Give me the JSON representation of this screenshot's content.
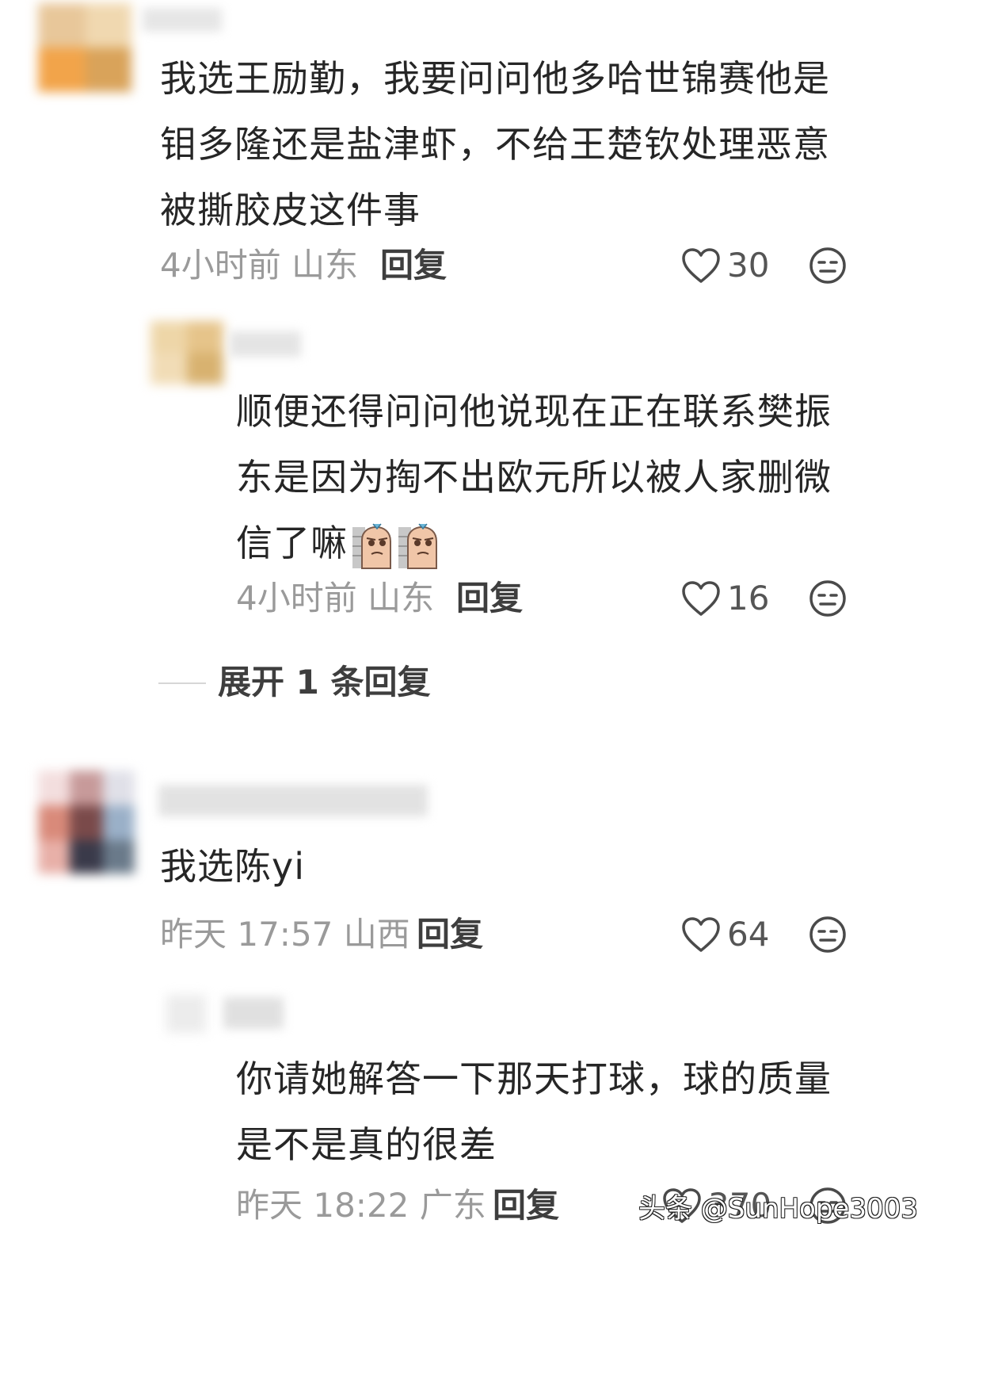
{
  "comments": [
    {
      "text": "我选王励勤，我要问问他多哈世锦赛他是钼多隆还是盐津虾，不给王楚钦处理恶意被撕胶皮这件事",
      "time": "4小时前",
      "location": "山东",
      "reply_label": "回复",
      "likes": "30"
    },
    {
      "text": "顺便还得问问他说现在正在联系樊振东是因为掏不出欧元所以被人家删微信了嘛",
      "time": "4小时前",
      "location": "山东",
      "reply_label": "回复",
      "likes": "16"
    },
    {
      "text": "我选陈yi",
      "time": "昨天 17:57",
      "location": "山西",
      "reply_label": "回复",
      "likes": "64"
    },
    {
      "text": "你请她解答一下那天打球，球的质量是不是真的很差",
      "time": "昨天 18:22",
      "location": "广东",
      "reply_label": "回复",
      "likes": "370"
    }
  ],
  "expand_replies": "展开 1 条回复",
  "watermark": "头条 @SunHope3003",
  "icons": {
    "like": "heart-outline-icon",
    "more": "face-neutral-icon",
    "emoji": "sausage-wall-emoji"
  },
  "colors": {
    "text": "#262626",
    "meta": "#9a9a9a",
    "reply": "#3e3e3e"
  }
}
